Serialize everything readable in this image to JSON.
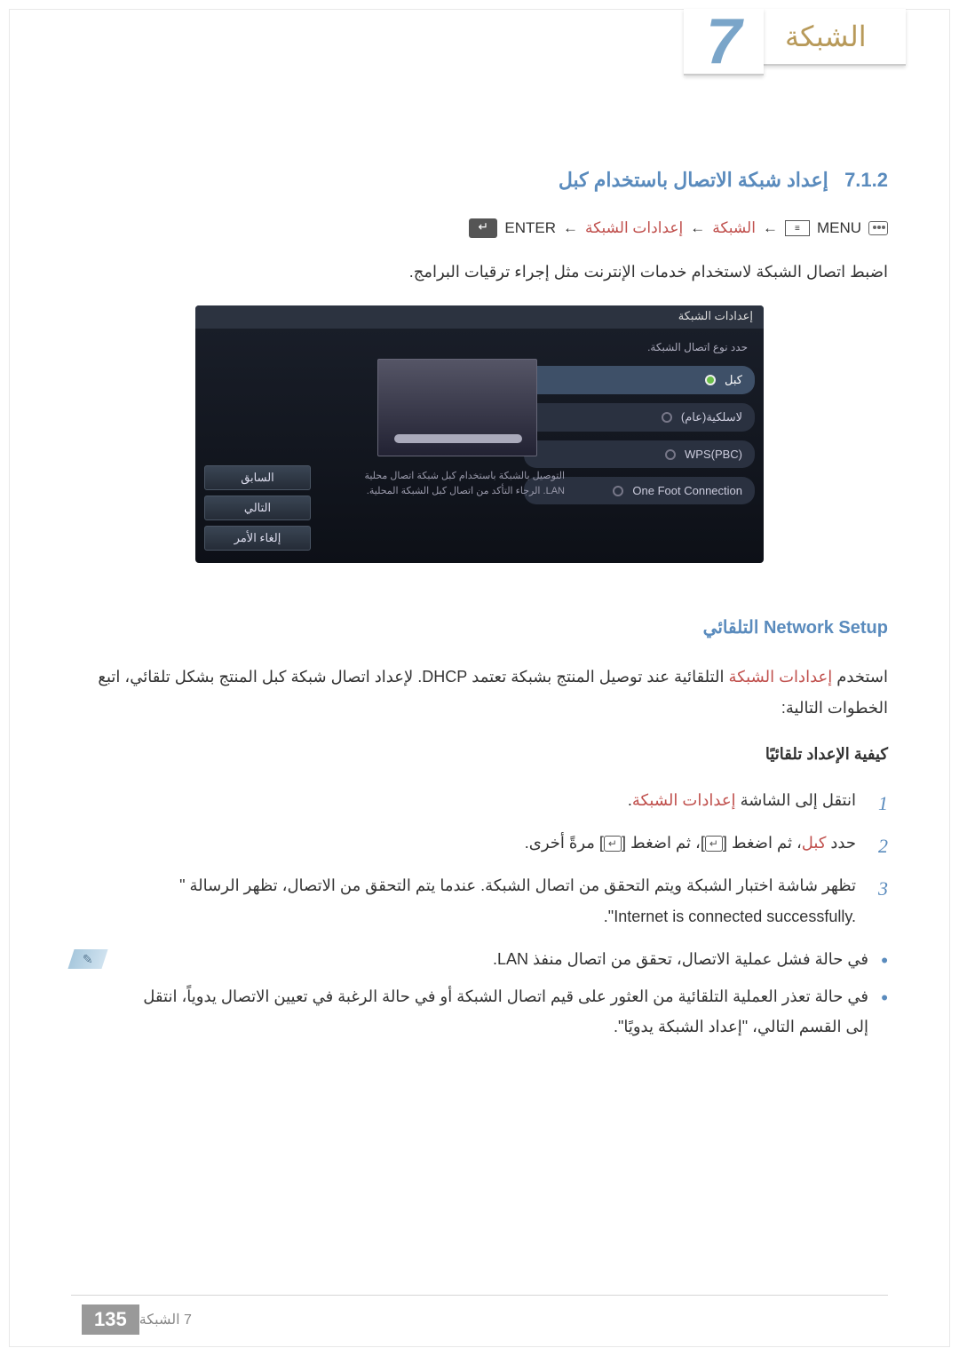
{
  "header": {
    "chapter_number": "7",
    "chapter_title": "الشبكة"
  },
  "section": {
    "number": "7.1.2",
    "title": "إعداد شبكة الاتصال باستخدام كبل"
  },
  "nav": {
    "menu": "MENU",
    "arrow": "←",
    "item1": "الشبكة",
    "item2": "إعدادات الشبكة",
    "enter": "ENTER"
  },
  "intro": "اضبط اتصال الشبكة لاستخدام خدمات الإنترنت مثل إجراء ترقيات البرامج.",
  "screenshot": {
    "title": "إعدادات الشبكة",
    "hint": "حدد نوع اتصال الشبكة.",
    "options": [
      "كبل",
      "لاسلكية(عام)",
      "WPS(PBC)",
      "One Foot Connection"
    ],
    "desc": "التوصيل بالشبكة باستخدام كبل شبكة اتصال محلية LAN. الرجاء التأكد من اتصال كبل الشبكة المحلية.",
    "buttons": {
      "prev": "السابق",
      "next": "التالي",
      "cancel": "إلغاء الأمر"
    }
  },
  "subsection": {
    "title": "Network Setup التلقائي",
    "intro_pre": "استخدم ",
    "intro_red": "إعدادات الشبكة",
    "intro_post": " التلقائية عند توصيل المنتج بشبكة تعتمد DHCP. لإعداد اتصال شبكة كبل المنتج بشكل تلقائي، اتبع الخطوات التالية:",
    "howto": "كيفية الإعداد تلقائيًا",
    "step1_pre": "انتقل إلى الشاشة ",
    "step1_red": "إعدادات الشبكة",
    "step1_post": ".",
    "step2_pre": "حدد ",
    "step2_red": "كبل",
    "step2_mid1": "، ثم اضغط [",
    "step2_mid2": "]، ثم اضغط [",
    "step2_post": "] مرةً أخرى.",
    "step3_a": "تظهر شاشة اختبار الشبكة ويتم التحقق من اتصال الشبكة. عندما يتم التحقق من الاتصال، تظهر الرسالة \"",
    "step3_b_ltr": "Internet is connected successfully.",
    "step3_c": "\".",
    "note1": "في حالة فشل عملية الاتصال، تحقق من اتصال منفذ LAN.",
    "note2": "في حالة تعذر العملية التلقائية من العثور على قيم اتصال الشبكة أو في حالة الرغبة في تعيين الاتصال يدوياً، انتقل إلى القسم التالي، \"إعداد الشبكة يدويًا\"."
  },
  "footer": {
    "page": "135",
    "label": "7 الشبكة"
  }
}
